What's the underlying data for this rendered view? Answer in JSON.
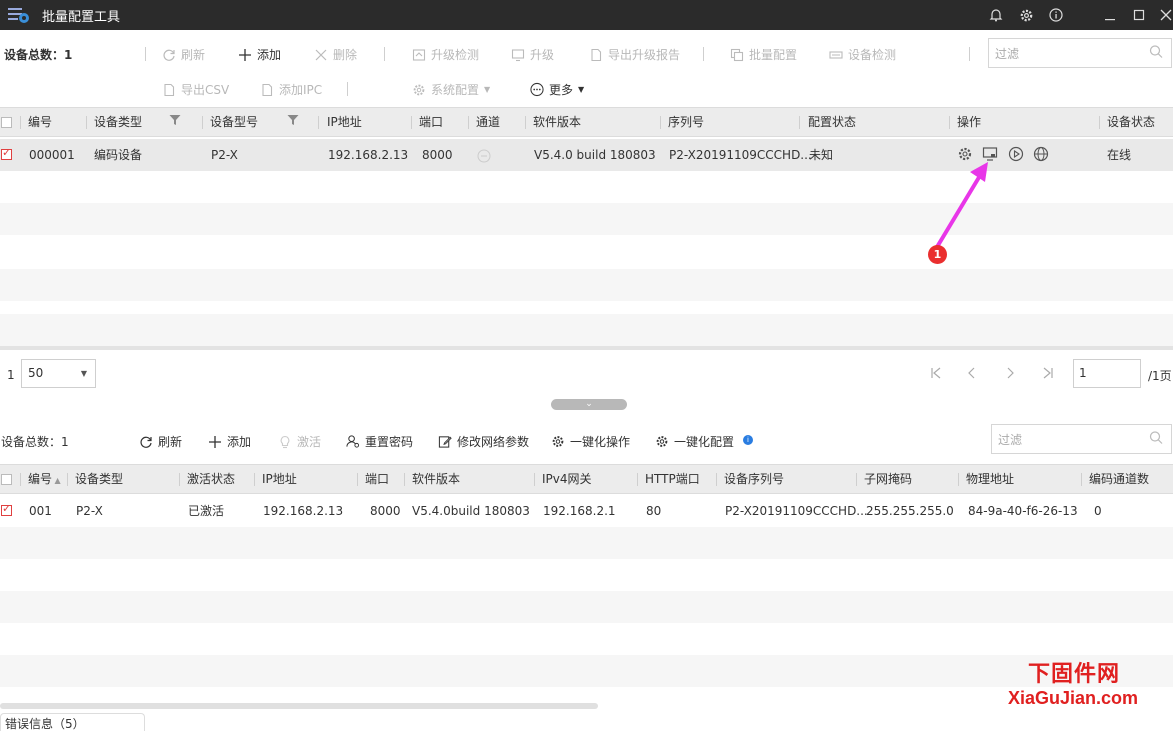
{
  "window": {
    "title": "批量配置工具"
  },
  "top": {
    "device_total": "设备总数：1",
    "toolbar": {
      "refresh": "刷新",
      "add": "添加",
      "delete": "删除",
      "upgrade_check": "升级检测",
      "upgrade": "升级",
      "export_upgrade_report": "导出升级报告",
      "batch_config": "批量配置",
      "device_check": "设备检测",
      "export_csv": "导出CSV",
      "add_ipc": "添加IPC",
      "system_config": "系统配置",
      "more": "更多"
    },
    "filter_placeholder": "过滤",
    "columns": {
      "id": "编号",
      "device_type": "设备类型",
      "model": "设备型号",
      "ip": "IP地址",
      "port": "端口",
      "channel": "通道",
      "software": "软件版本",
      "serial": "序列号",
      "config_status": "配置状态",
      "operation": "操作",
      "device_status": "设备状态"
    },
    "rows": [
      {
        "id": "000001",
        "device_type": "编码设备",
        "model": "P2-X",
        "ip": "192.168.2.13",
        "port": "8000",
        "software": "V5.4.0 build 180803",
        "serial": "P2-X20191109CCCHD...",
        "config_status": "未知",
        "device_status": "在线"
      }
    ]
  },
  "pager": {
    "index": "1",
    "page_size": "50",
    "page_input": "1",
    "page_total": "/1页"
  },
  "annotation": {
    "badge": "1"
  },
  "bottom": {
    "device_total": "设备总数：1",
    "toolbar": {
      "refresh": "刷新",
      "add": "添加",
      "activate": "激活",
      "reset_password": "重置密码",
      "modify_network": "修改网络参数",
      "one_click_op": "一键化操作",
      "one_click_config": "一键化配置"
    },
    "info_badge": "i",
    "filter_placeholder": "过滤",
    "columns": {
      "id": "编号",
      "device_type": "设备类型",
      "activation": "激活状态",
      "ip": "IP地址",
      "port": "端口",
      "software": "软件版本",
      "gateway": "IPv4网关",
      "http_port": "HTTP端口",
      "serial": "设备序列号",
      "mask": "子网掩码",
      "mac": "物理地址",
      "enc_channels": "编码通道数"
    },
    "rows": [
      {
        "id": "001",
        "device_type": "P2-X",
        "activation": "已激活",
        "ip": "192.168.2.13",
        "port": "8000",
        "software": "V5.4.0build 180803",
        "gateway": "192.168.2.1",
        "http_port": "80",
        "serial": "P2-X20191109CCCHD...",
        "mask": "255.255.255.0",
        "mac": "84-9a-40-f6-26-13",
        "enc_channels": "0"
      }
    ]
  },
  "status_tab": {
    "label": "错误信息（5）"
  },
  "watermark": {
    "cn": "下固件网",
    "en": "XiaGuJian.com"
  }
}
